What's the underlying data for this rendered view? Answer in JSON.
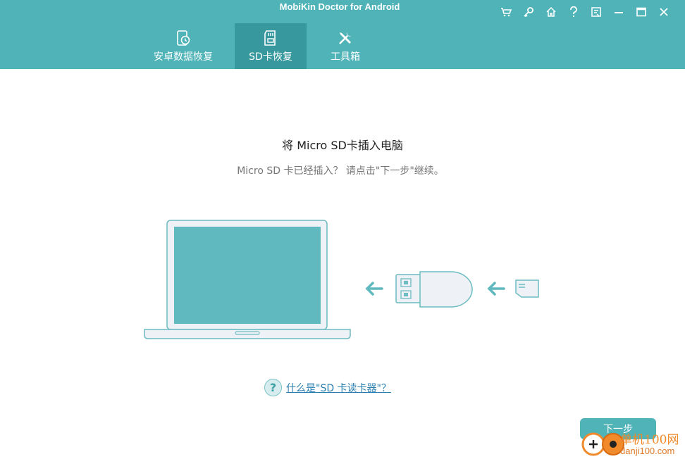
{
  "app": {
    "title": "MobiKin Doctor for Android"
  },
  "window_controls": [
    {
      "name": "cart-icon"
    },
    {
      "name": "key-icon"
    },
    {
      "name": "home-icon"
    },
    {
      "name": "help-icon"
    },
    {
      "name": "feedback-icon"
    },
    {
      "name": "minimize-icon"
    },
    {
      "name": "maximize-icon"
    },
    {
      "name": "close-icon"
    }
  ],
  "tabs": [
    {
      "label": "安卓数据恢复",
      "icon": "phone-restore-icon",
      "active": false
    },
    {
      "label": "SD卡恢复",
      "icon": "sd-card-icon",
      "active": true
    },
    {
      "label": "工具箱",
      "icon": "tools-icon",
      "active": false
    }
  ],
  "main": {
    "heading": "将 Micro SD卡插入电脑",
    "subheading": "Micro SD 卡已经插入？ 请点击\"下一步\"继续。",
    "help_icon": "?",
    "help_link": "什么是\"SD 卡读卡器\"？",
    "next_button": "下一步"
  },
  "watermark": {
    "line1": "单机100网",
    "line2": "danji100.com"
  },
  "colors": {
    "accent": "#4fb3b8",
    "accent_dark": "#37989d",
    "link": "#2b7fb0",
    "watermark": "#f08a2a"
  }
}
